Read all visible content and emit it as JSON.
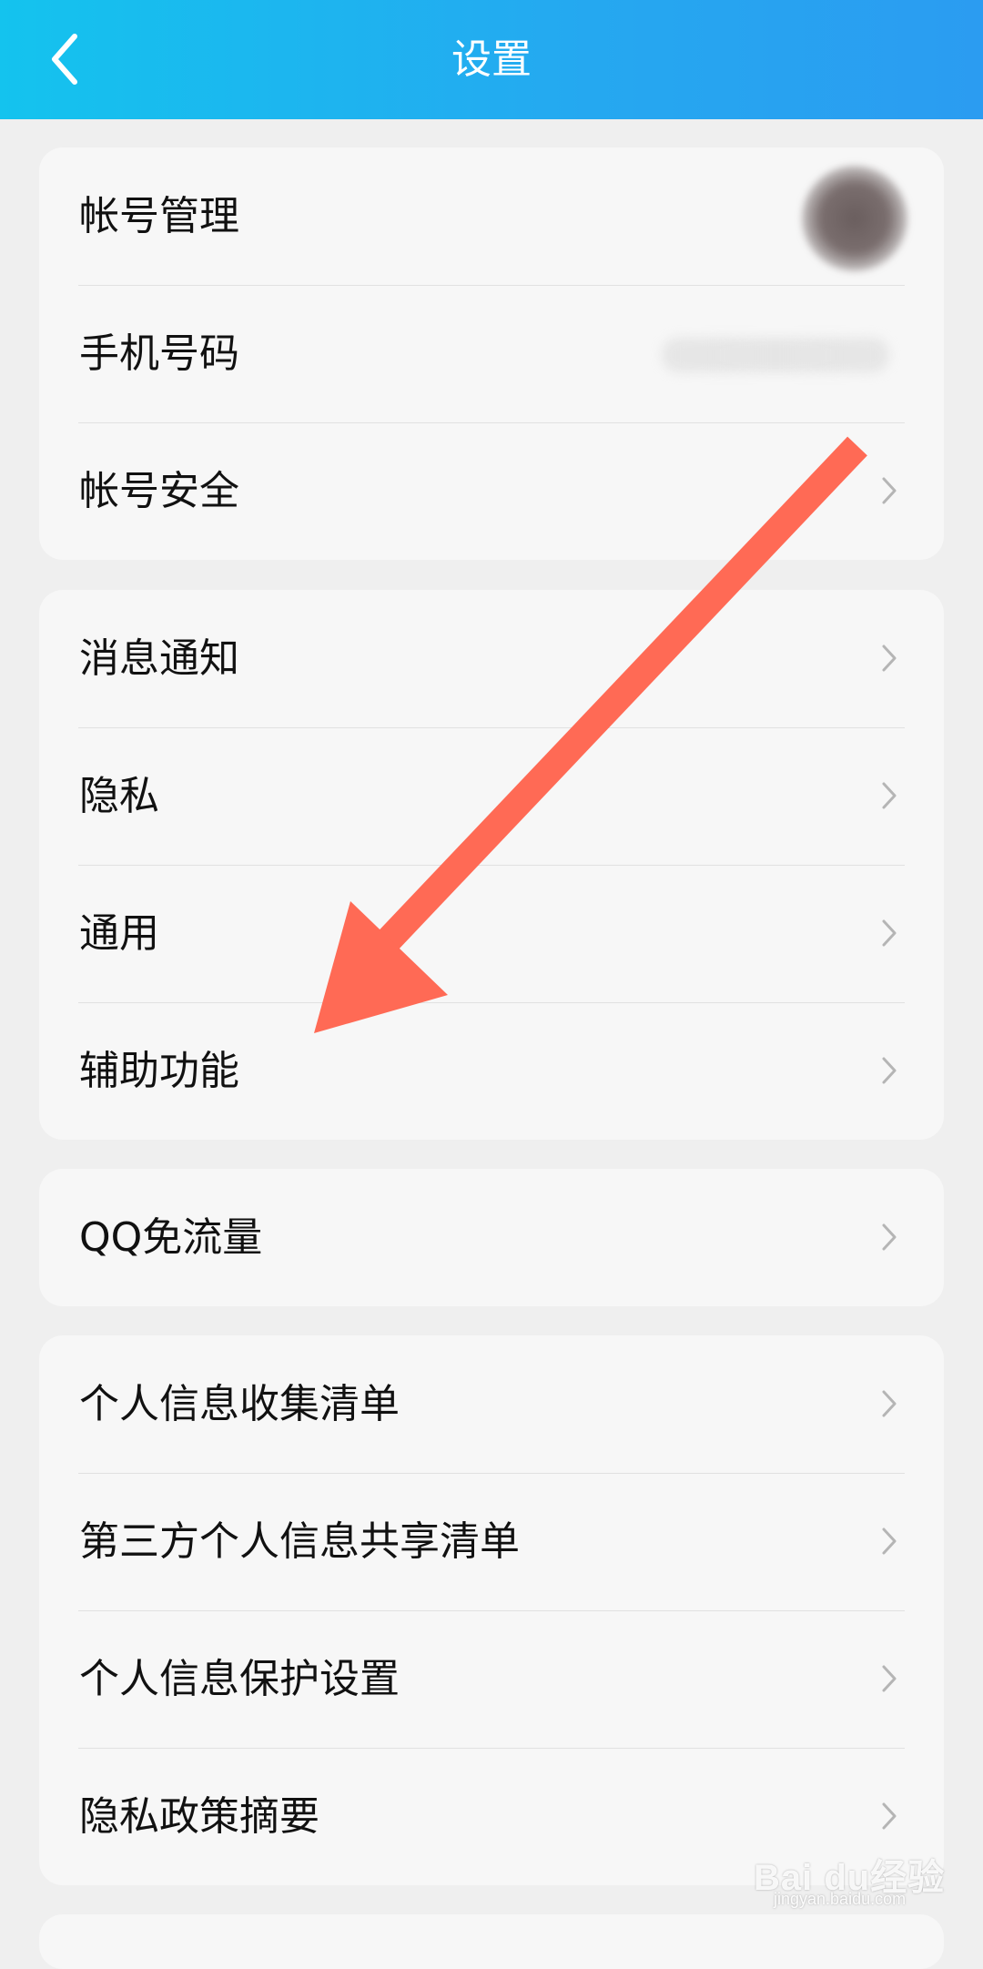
{
  "header": {
    "title": "设置"
  },
  "groups": [
    {
      "items": [
        {
          "label": "帐号管理"
        },
        {
          "label": "手机号码"
        },
        {
          "label": "帐号安全"
        }
      ]
    },
    {
      "items": [
        {
          "label": "消息通知"
        },
        {
          "label": "隐私"
        },
        {
          "label": "通用"
        },
        {
          "label": "辅助功能"
        }
      ]
    },
    {
      "items": [
        {
          "label": "QQ免流量"
        }
      ]
    },
    {
      "items": [
        {
          "label": "个人信息收集清单"
        },
        {
          "label": "第三方个人信息共享清单"
        },
        {
          "label": "个人信息保护设置"
        },
        {
          "label": "隐私政策摘要"
        }
      ]
    }
  ],
  "annotation": {
    "arrow_color": "#ff6a55"
  },
  "watermark": {
    "main": "Bai du经验",
    "sub": "jingyan.baidu.com"
  },
  "colors": {
    "header_start": "#14c3ee",
    "header_end": "#2b9cf1",
    "chevron": "#b5b5b5"
  }
}
